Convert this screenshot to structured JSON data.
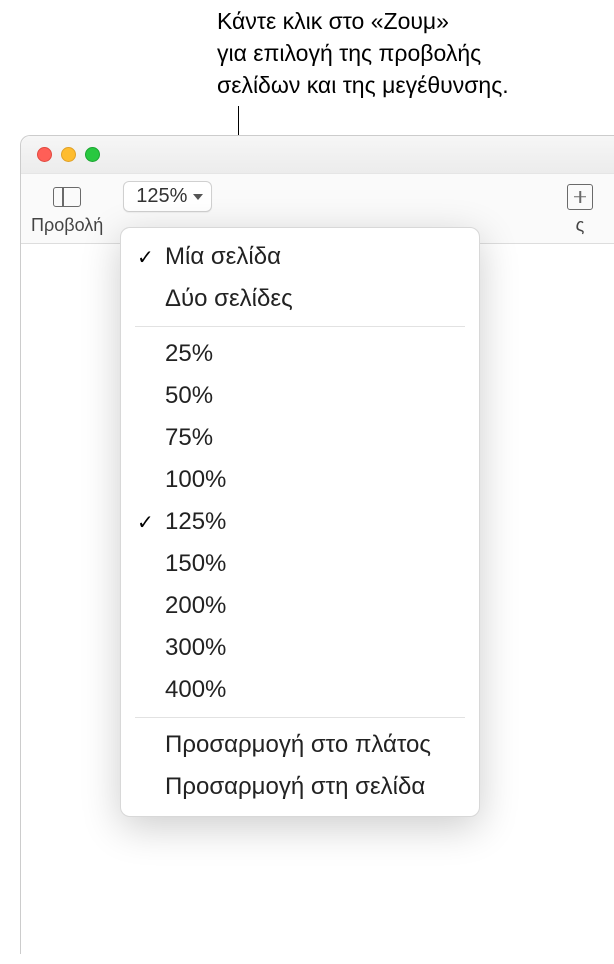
{
  "callout": {
    "line1": "Κάντε κλικ στο «Ζουμ»",
    "line2": "για επιλογή της προβολής",
    "line3": "σελίδων και της μεγέθυνσης."
  },
  "toolbar": {
    "view_label": "Προβολή",
    "zoom_value": "125%",
    "add_label": "ς"
  },
  "menu": {
    "page_views": [
      {
        "label": "Μία σελίδα",
        "checked": true
      },
      {
        "label": "Δύο σελίδες",
        "checked": false
      }
    ],
    "zoom_levels": [
      {
        "label": "25%",
        "checked": false
      },
      {
        "label": "50%",
        "checked": false
      },
      {
        "label": "75%",
        "checked": false
      },
      {
        "label": "100%",
        "checked": false
      },
      {
        "label": "125%",
        "checked": true
      },
      {
        "label": "150%",
        "checked": false
      },
      {
        "label": "200%",
        "checked": false
      },
      {
        "label": "300%",
        "checked": false
      },
      {
        "label": "400%",
        "checked": false
      }
    ],
    "fit_options": [
      {
        "label": "Προσαρμογή στο πλάτος"
      },
      {
        "label": "Προσαρμογή στη σελίδα"
      }
    ]
  }
}
